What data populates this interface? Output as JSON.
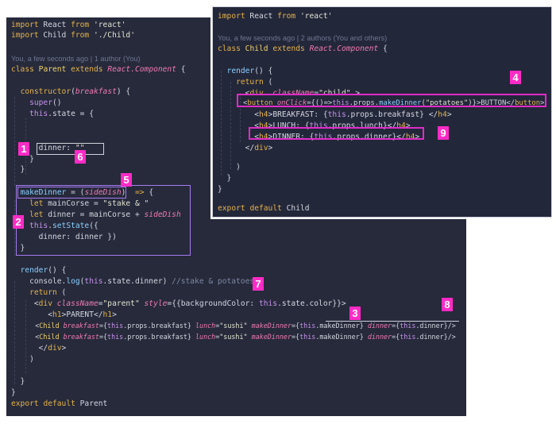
{
  "parent": {
    "lines": [
      "import React from 'react'",
      "import Child from './Child'",
      "",
      "You, a few seconds ago | 1 author (You)",
      "class Parent extends React.Component {",
      "",
      "  constructor(breakfast) {",
      "    super()",
      "    this.state = {",
      "",
      "",
      "      dinner: \"\"",
      "    }",
      "  }",
      "",
      "  makeDinner = (sideDish) => {",
      "    let mainCorse = \"stake & \"",
      "    let dinner = mainCorse + sideDish",
      "    this.setState({",
      "      dinner: dinner })",
      "  }",
      "",
      "  render() {",
      "    console.log(this.state.dinner) //stake & potatoes",
      "    return (",
      "     <div className=\"parent\" style={{backgroundColor: this.state.color}}>",
      "        <h1>PARENT</h1>",
      "      <Child breakfast={this.props.breakfast} lunch=\"sushi\" makeDinner={this.makeDinner} dinner={this.dinner}/>",
      "      <Child breakfast={this.props.breakfast} lunch=\"sushi\" makeDinner={this.makeDinner} dinner={this.dinner}/>",
      "      </div>",
      "    )",
      "",
      "  }",
      "}",
      "export default Parent"
    ]
  },
  "child": {
    "lines": [
      "import React from 'react'",
      "",
      "You, a few seconds ago | 2 authors (You and others)",
      "class Child extends React.Component {",
      "",
      "  render() {",
      "    return (",
      "      <div  className=\"child\" >",
      "      <button onClick={()=>this.props.makeDinner(\"potatoes\")}>BUTTON</button>",
      "        <h4>BREAKFAST: {this.props.breakfast} </h4>",
      "        <h4>LUNCH: {this.props.lunch}</h4>",
      "        <h4>DINNER: {this.props.dinner}</h4>",
      "      </div>",
      "",
      "    )",
      "  }",
      "}",
      "",
      "export default Child"
    ]
  },
  "badges": [
    "1",
    "2",
    "3",
    "4",
    "5",
    "6",
    "7",
    "8",
    "9"
  ],
  "colors": {
    "badge": "#ff2bc6",
    "box_purple": "#a77bf0",
    "box_magenta": "#e12cc8",
    "editor_bg": "#262a3b"
  }
}
